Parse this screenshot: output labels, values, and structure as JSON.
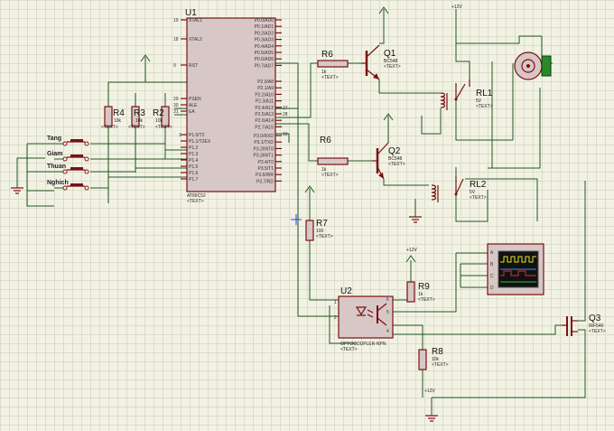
{
  "components": {
    "u1": {
      "ref": "U1",
      "part": "AT89C52",
      "text": "<TEXT>"
    },
    "u1_pins_left": [
      "XTAL1",
      "XTAL2",
      "RST",
      "PSEN",
      "ALE",
      "EA",
      "P1.0/T2",
      "P1.1/T2EX",
      "P1.2",
      "P1.3",
      "P1.4",
      "P1.5",
      "P1.6",
      "P1.7"
    ],
    "u1_pins_right": [
      "P0.0/AD0",
      "P0.1/AD1",
      "P0.2/AD2",
      "P0.3/AD3",
      "P0.4/AD4",
      "P0.5/AD5",
      "P0.6/AD6",
      "P0.7/AD7",
      "P2.0/A8",
      "P2.1/A9",
      "P2.2/A10",
      "P2.3/A11",
      "P2.4/A12",
      "P2.5/A13",
      "P2.6/A14",
      "P2.7/A15",
      "P3.0/RXD",
      "P3.1/TXD",
      "P3.2/INT0",
      "P3.3/INT1",
      "P3.4/T0",
      "P3.5/T1",
      "P3.6/WR",
      "P3.7/RD"
    ],
    "r4": {
      "ref": "R4",
      "value": "10k",
      "text": "<TEXT>"
    },
    "r3": {
      "ref": "R3",
      "value": "10k",
      "text": "<TEXT>"
    },
    "r2": {
      "ref": "R2",
      "value": "10k",
      "text": "<TEXT>"
    },
    "r6a": {
      "ref": "R6",
      "value": "1k",
      "text": "<TEXT>"
    },
    "r6b": {
      "ref": "R6",
      "value": "1k",
      "text": "<TEXT>"
    },
    "r7": {
      "ref": "R7",
      "value": "100",
      "text": "<TEXT>"
    },
    "r9": {
      "ref": "R9",
      "value": "1k",
      "text": "<TEXT>"
    },
    "r8": {
      "ref": "R8",
      "value": "10k",
      "text": "<TEXT>"
    },
    "q1": {
      "ref": "Q1",
      "part": "BC548",
      "text": "<TEXT>"
    },
    "q2": {
      "ref": "Q2",
      "part": "BC548",
      "text": "<TEXT>"
    },
    "q3": {
      "ref": "Q3",
      "part": "IRF540",
      "text": "<TEXT>"
    },
    "rl1": {
      "ref": "RL1",
      "value": "5V",
      "text": "<TEXT>"
    },
    "rl2": {
      "ref": "RL2",
      "value": "5V",
      "text": "<TEXT>"
    },
    "u2": {
      "ref": "U2",
      "part": "OPTOCOUPLER-NPN",
      "text": "<TEXT>"
    }
  },
  "switches": [
    "Tang",
    "Giam",
    "Thuan",
    "Nghich"
  ],
  "power": {
    "v12_top": "+12V",
    "v12_mid": "+12V",
    "v12_bot": "+12V"
  },
  "scope_channels": [
    "A",
    "B",
    "C",
    "D"
  ],
  "pin_numbers": {
    "xtal1": "19",
    "xtal2": "18",
    "rst": "9",
    "psen": "29",
    "ale": "30",
    "ea": "31",
    "p1_0": "1",
    "p2_6": "27",
    "p2_7": "28",
    "p3_0": "10",
    "u2_p1": "1",
    "u2_p2": "2",
    "u2_p4": "4",
    "u2_p5": "5",
    "u2_p6": "6"
  }
}
